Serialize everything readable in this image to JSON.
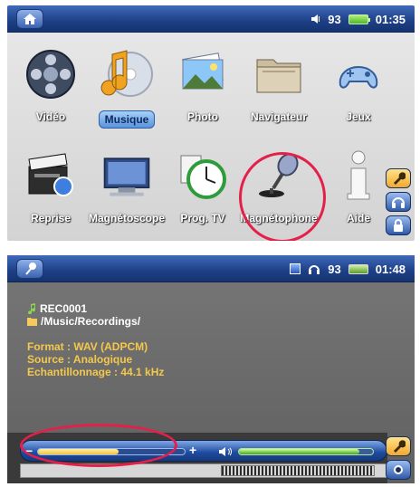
{
  "screen1": {
    "status": {
      "volume": "93",
      "time": "01:35"
    },
    "menu": [
      {
        "label": "Vidéo",
        "icon": "film-reel-icon"
      },
      {
        "label": "Musique",
        "icon": "music-cd-icon",
        "selected": true
      },
      {
        "label": "Photo",
        "icon": "photo-stack-icon"
      },
      {
        "label": "Navigateur",
        "icon": "folder-icon"
      },
      {
        "label": "Jeux",
        "icon": "gamepad-icon"
      },
      {
        "label": "Reprise",
        "icon": "clapperboard-icon"
      },
      {
        "label": "Magnétoscope",
        "icon": "tv-screen-icon"
      },
      {
        "label": "Prog. TV",
        "icon": "clock-icon"
      },
      {
        "label": "Magnétophone",
        "icon": "microphone-icon"
      },
      {
        "label": "Aide",
        "icon": "info-icon"
      }
    ],
    "side_buttons": [
      "wrench-icon",
      "headphones-icon",
      "lock-icon"
    ]
  },
  "screen2": {
    "status": {
      "volume": "93",
      "time": "01:48"
    },
    "file_name": "REC0001",
    "folder": "/Music/Recordings/",
    "format": "Format : WAV (ADPCM)",
    "source": "Source : Analogique",
    "sampling": "Echantillonnage : 44.1 kHz",
    "progress_fraction": 0.55,
    "volume_fraction": 0.9,
    "side_buttons": [
      "wrench-icon",
      "record-icon"
    ]
  }
}
